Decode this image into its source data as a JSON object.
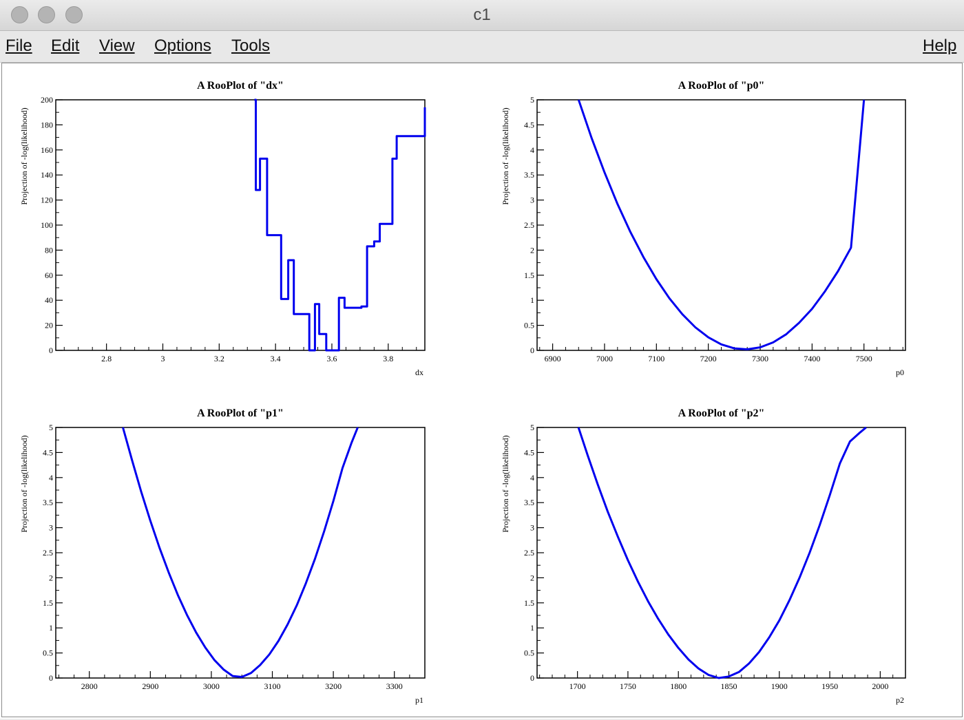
{
  "window": {
    "title": "c1"
  },
  "menu": {
    "file": "File",
    "edit": "Edit",
    "view": "View",
    "options": "Options",
    "tools": "Tools",
    "help": "Help"
  },
  "colors": {
    "curve": "#0000ee",
    "frame": "#000000",
    "background": "#ffffff"
  },
  "chart_data": [
    {
      "type": "line",
      "title": "A RooPlot of \"dx\"",
      "xlabel": "dx",
      "ylabel": "Projection of -log(likelihood)",
      "xlim": [
        2.62,
        3.93
      ],
      "ylim": [
        0,
        200
      ],
      "xticks": [
        2.8,
        3.0,
        3.2,
        3.4,
        3.6,
        3.8
      ],
      "xtick_labels": [
        "2.8",
        "3",
        "3.2",
        "3.4",
        "3.6",
        "3.8"
      ],
      "yticks": [
        0,
        20,
        40,
        60,
        80,
        100,
        120,
        140,
        160,
        180,
        200
      ],
      "ytick_labels": [
        "0",
        "20",
        "40",
        "60",
        "80",
        "100",
        "120",
        "140",
        "160",
        "180",
        "200"
      ],
      "series": [
        {
          "x": [
            3.325,
            3.33,
            3.33,
            3.345,
            3.345,
            3.37,
            3.37,
            3.42,
            3.42,
            3.445,
            3.445,
            3.465,
            3.465,
            3.52,
            3.52,
            3.54,
            3.54,
            3.555,
            3.555,
            3.58,
            3.58,
            3.625,
            3.625,
            3.645,
            3.645,
            3.665,
            3.665,
            3.705,
            3.705,
            3.725,
            3.725,
            3.75,
            3.75,
            3.77,
            3.77,
            3.815,
            3.815,
            3.83,
            3.83,
            3.86,
            3.86,
            3.905,
            3.905,
            3.93,
            3.93
          ],
          "y": [
            200,
            200,
            128,
            128,
            153,
            153,
            92,
            92,
            41,
            41,
            72,
            72,
            29,
            29,
            0,
            0,
            37,
            37,
            13,
            13,
            0,
            0,
            42,
            42,
            34,
            34,
            34,
            34,
            35,
            35,
            83,
            83,
            87,
            87,
            101,
            101,
            153,
            153,
            171,
            171,
            171,
            171,
            171,
            171,
            194
          ]
        }
      ]
    },
    {
      "type": "line",
      "title": "A RooPlot of \"p0\"",
      "xlabel": "p0",
      "ylabel": "Projection of -log(likelihood)",
      "xlim": [
        6870,
        7580
      ],
      "ylim": [
        0,
        5
      ],
      "xticks": [
        6900,
        7000,
        7100,
        7200,
        7300,
        7400,
        7500
      ],
      "xtick_labels": [
        "6900",
        "7000",
        "7100",
        "7200",
        "7300",
        "7400",
        "7500"
      ],
      "yticks": [
        0,
        0.5,
        1,
        1.5,
        2,
        2.5,
        3,
        3.5,
        4,
        4.5,
        5
      ],
      "ytick_labels": [
        "0",
        "0.5",
        "1",
        "1.5",
        "2",
        "2.5",
        "3",
        "3.5",
        "4",
        "4.5",
        "5"
      ],
      "series": [
        {
          "x": [
            6950,
            6975,
            7000,
            7025,
            7050,
            7075,
            7100,
            7125,
            7150,
            7175,
            7200,
            7225,
            7250,
            7275,
            7300,
            7325,
            7350,
            7375,
            7400,
            7425,
            7450,
            7475,
            7500
          ],
          "y": [
            5.0,
            4.24,
            3.55,
            2.92,
            2.36,
            1.86,
            1.42,
            1.04,
            0.72,
            0.46,
            0.26,
            0.12,
            0.04,
            0.02,
            0.06,
            0.16,
            0.32,
            0.55,
            0.83,
            1.18,
            1.58,
            2.05,
            5.0
          ]
        }
      ]
    },
    {
      "type": "line",
      "title": "A RooPlot of \"p1\"",
      "xlabel": "p1",
      "ylabel": "Projection of -log(likelihood)",
      "xlim": [
        2745,
        3350
      ],
      "ylim": [
        0,
        5
      ],
      "xticks": [
        2800,
        2900,
        3000,
        3100,
        3200,
        3300
      ],
      "xtick_labels": [
        "2800",
        "2900",
        "3000",
        "3100",
        "3200",
        "3300"
      ],
      "yticks": [
        0,
        0.5,
        1,
        1.5,
        2,
        2.5,
        3,
        3.5,
        4,
        4.5,
        5
      ],
      "ytick_labels": [
        "0",
        "0.5",
        "1",
        "1.5",
        "2",
        "2.5",
        "3",
        "3.5",
        "4",
        "4.5",
        "5"
      ],
      "series": [
        {
          "x": [
            2855,
            2870,
            2885,
            2900,
            2915,
            2930,
            2945,
            2960,
            2975,
            2990,
            3005,
            3020,
            3035,
            3050,
            3065,
            3080,
            3095,
            3110,
            3125,
            3140,
            3155,
            3170,
            3185,
            3200,
            3215,
            3230,
            3240
          ],
          "y": [
            5.0,
            4.35,
            3.72,
            3.14,
            2.6,
            2.11,
            1.66,
            1.26,
            0.91,
            0.61,
            0.36,
            0.17,
            0.04,
            0.02,
            0.1,
            0.26,
            0.47,
            0.74,
            1.07,
            1.45,
            1.89,
            2.38,
            2.93,
            3.53,
            4.19,
            4.7,
            5.0
          ]
        }
      ]
    },
    {
      "type": "line",
      "title": "A RooPlot of \"p2\"",
      "xlabel": "p2",
      "ylabel": "Projection of -log(likelihood)",
      "xlim": [
        1660,
        2025
      ],
      "ylim": [
        0,
        5
      ],
      "xticks": [
        1700,
        1750,
        1800,
        1850,
        1900,
        1950,
        2000
      ],
      "xtick_labels": [
        "1700",
        "1750",
        "1800",
        "1850",
        "1900",
        "1950",
        "2000"
      ],
      "yticks": [
        0,
        0.5,
        1,
        1.5,
        2,
        2.5,
        3,
        3.5,
        4,
        4.5,
        5
      ],
      "ytick_labels": [
        "0",
        "0.5",
        "1",
        "1.5",
        "2",
        "2.5",
        "3",
        "3.5",
        "4",
        "4.5",
        "5"
      ],
      "series": [
        {
          "x": [
            1701,
            1710,
            1720,
            1730,
            1740,
            1750,
            1760,
            1770,
            1780,
            1790,
            1800,
            1810,
            1820,
            1830,
            1840,
            1850,
            1860,
            1870,
            1880,
            1890,
            1900,
            1910,
            1920,
            1930,
            1940,
            1950,
            1960,
            1970,
            1980,
            1986
          ],
          "y": [
            5.0,
            4.45,
            3.87,
            3.32,
            2.82,
            2.35,
            1.92,
            1.53,
            1.18,
            0.87,
            0.6,
            0.37,
            0.19,
            0.06,
            0.0,
            0.03,
            0.12,
            0.29,
            0.52,
            0.81,
            1.15,
            1.55,
            2.0,
            2.5,
            3.05,
            3.65,
            4.28,
            4.72,
            4.9,
            5.0
          ]
        }
      ]
    }
  ]
}
